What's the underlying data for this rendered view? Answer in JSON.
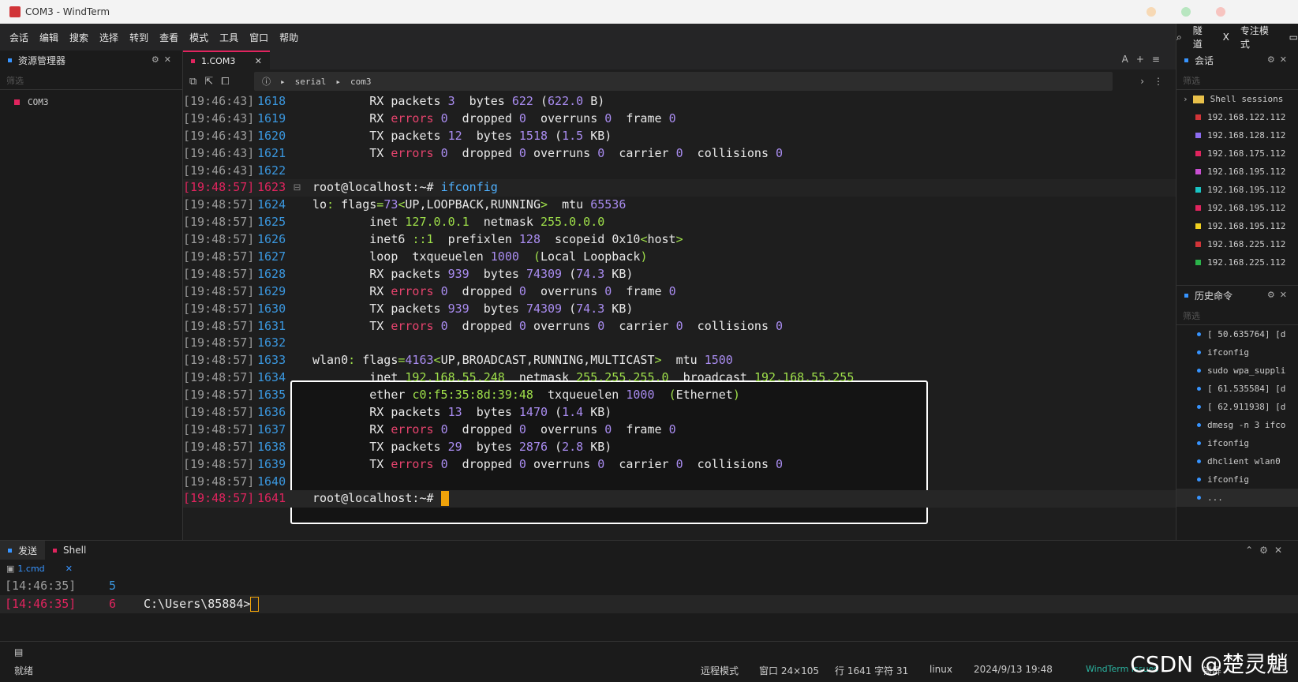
{
  "window": {
    "title": "COM3 - WindTerm"
  },
  "menu": [
    "会话",
    "编辑",
    "搜索",
    "选择",
    "转到",
    "查看",
    "模式",
    "工具",
    "窗口",
    "帮助"
  ],
  "menu_right": {
    "tunnel": "隧道",
    "x": "X",
    "focus": "专注模式"
  },
  "explorer": {
    "title": "资源管理器",
    "filter_placeholder": "筛选",
    "items": [
      {
        "label": "COM3",
        "color": "#e0245e"
      }
    ]
  },
  "tab": {
    "label": "1.COM3"
  },
  "address": {
    "p1": "serial",
    "p2": "com3"
  },
  "terminal": {
    "lines": [
      {
        "ts": "[19:46:43]",
        "ln": "1618",
        "parts": [
          [
            "",
            "        RX packets "
          ],
          [
            "num",
            "3"
          ],
          [
            "",
            "  bytes "
          ],
          [
            "num",
            "622"
          ],
          [
            "",
            " ("
          ],
          [
            "num",
            "622.0"
          ],
          [
            "",
            " B)"
          ]
        ]
      },
      {
        "ts": "[19:46:43]",
        "ln": "1619",
        "parts": [
          [
            "",
            "        RX "
          ],
          [
            "red",
            "errors"
          ],
          [
            "",
            " "
          ],
          [
            "num",
            "0"
          ],
          [
            "",
            "  dropped "
          ],
          [
            "num",
            "0"
          ],
          [
            "",
            "  overruns "
          ],
          [
            "num",
            "0"
          ],
          [
            "",
            "  frame "
          ],
          [
            "num",
            "0"
          ]
        ]
      },
      {
        "ts": "[19:46:43]",
        "ln": "1620",
        "parts": [
          [
            "",
            "        TX packets "
          ],
          [
            "num",
            "12"
          ],
          [
            "",
            "  bytes "
          ],
          [
            "num",
            "1518"
          ],
          [
            "",
            " ("
          ],
          [
            "num",
            "1.5"
          ],
          [
            "",
            " KB)"
          ]
        ]
      },
      {
        "ts": "[19:46:43]",
        "ln": "1621",
        "parts": [
          [
            "",
            "        TX "
          ],
          [
            "red",
            "errors"
          ],
          [
            "",
            " "
          ],
          [
            "num",
            "0"
          ],
          [
            "",
            "  dropped "
          ],
          [
            "num",
            "0"
          ],
          [
            "",
            " overruns "
          ],
          [
            "num",
            "0"
          ],
          [
            "",
            "  carrier "
          ],
          [
            "num",
            "0"
          ],
          [
            "",
            "  collisions "
          ],
          [
            "num",
            "0"
          ]
        ]
      },
      {
        "ts": "[19:46:43]",
        "ln": "1622",
        "parts": []
      },
      {
        "ts": "[19:48:57]",
        "ln": "1623",
        "parts": [
          [
            "",
            "root@localhost:~# "
          ],
          [
            "cmd",
            "ifconfig"
          ]
        ]
      },
      {
        "ts": "[19:48:57]",
        "ln": "1624",
        "parts": [
          [
            "",
            "lo"
          ],
          [
            "grn",
            ":"
          ],
          [
            "",
            " flags"
          ],
          [
            "grn",
            "="
          ],
          [
            "num",
            "73"
          ],
          [
            "grn",
            "<"
          ],
          [
            "",
            "UP,LOOPBACK,RUNNING"
          ],
          [
            "grn",
            ">"
          ],
          [
            "",
            "  mtu "
          ],
          [
            "num",
            "65536"
          ]
        ]
      },
      {
        "ts": "[19:48:57]",
        "ln": "1625",
        "parts": [
          [
            "",
            "        inet "
          ],
          [
            "grn",
            "127.0.0.1"
          ],
          [
            "",
            "  netmask "
          ],
          [
            "grn",
            "255.0.0.0"
          ]
        ]
      },
      {
        "ts": "[19:48:57]",
        "ln": "1626",
        "parts": [
          [
            "",
            "        inet6 "
          ],
          [
            "grn",
            "::1"
          ],
          [
            "",
            "  prefixlen "
          ],
          [
            "num",
            "128"
          ],
          [
            "",
            "  scopeid "
          ],
          [
            "",
            "0x10"
          ],
          [
            "grn",
            "<"
          ],
          [
            "",
            "host"
          ],
          [
            "grn",
            ">"
          ]
        ]
      },
      {
        "ts": "[19:48:57]",
        "ln": "1627",
        "parts": [
          [
            "",
            "        loop  txqueuelen "
          ],
          [
            "num",
            "1000"
          ],
          [
            "",
            "  "
          ],
          [
            "grn",
            "("
          ],
          [
            "",
            "Local Loopback"
          ],
          [
            "grn",
            ")"
          ]
        ]
      },
      {
        "ts": "[19:48:57]",
        "ln": "1628",
        "parts": [
          [
            "",
            "        RX packets "
          ],
          [
            "num",
            "939"
          ],
          [
            "",
            "  bytes "
          ],
          [
            "num",
            "74309"
          ],
          [
            "",
            " ("
          ],
          [
            "num",
            "74.3"
          ],
          [
            "",
            " KB)"
          ]
        ]
      },
      {
        "ts": "[19:48:57]",
        "ln": "1629",
        "parts": [
          [
            "",
            "        RX "
          ],
          [
            "red",
            "errors"
          ],
          [
            "",
            " "
          ],
          [
            "num",
            "0"
          ],
          [
            "",
            "  dropped "
          ],
          [
            "num",
            "0"
          ],
          [
            "",
            "  overruns "
          ],
          [
            "num",
            "0"
          ],
          [
            "",
            "  frame "
          ],
          [
            "num",
            "0"
          ]
        ]
      },
      {
        "ts": "[19:48:57]",
        "ln": "1630",
        "parts": [
          [
            "",
            "        TX packets "
          ],
          [
            "num",
            "939"
          ],
          [
            "",
            "  bytes "
          ],
          [
            "num",
            "74309"
          ],
          [
            "",
            " ("
          ],
          [
            "num",
            "74.3"
          ],
          [
            "",
            " KB)"
          ]
        ]
      },
      {
        "ts": "[19:48:57]",
        "ln": "1631",
        "parts": [
          [
            "",
            "        TX "
          ],
          [
            "red",
            "errors"
          ],
          [
            "",
            " "
          ],
          [
            "num",
            "0"
          ],
          [
            "",
            "  dropped "
          ],
          [
            "num",
            "0"
          ],
          [
            "",
            " overruns "
          ],
          [
            "num",
            "0"
          ],
          [
            "",
            "  carrier "
          ],
          [
            "num",
            "0"
          ],
          [
            "",
            "  collisions "
          ],
          [
            "num",
            "0"
          ]
        ]
      },
      {
        "ts": "[19:48:57]",
        "ln": "1632",
        "parts": []
      },
      {
        "ts": "[19:48:57]",
        "ln": "1633",
        "parts": [
          [
            "",
            "wlan0"
          ],
          [
            "grn",
            ":"
          ],
          [
            "",
            " flags"
          ],
          [
            "grn",
            "="
          ],
          [
            "num",
            "4163"
          ],
          [
            "grn",
            "<"
          ],
          [
            "",
            "UP,BROADCAST,RUNNING,MULTICAST"
          ],
          [
            "grn",
            ">"
          ],
          [
            "",
            "  mtu "
          ],
          [
            "num",
            "1500"
          ]
        ]
      },
      {
        "ts": "[19:48:57]",
        "ln": "1634",
        "parts": [
          [
            "",
            "        inet "
          ],
          [
            "grn",
            "192.168.55.248"
          ],
          [
            "",
            "  netmask "
          ],
          [
            "grn",
            "255.255.255.0"
          ],
          [
            "",
            "  broadcast "
          ],
          [
            "grn",
            "192.168.55.255"
          ]
        ]
      },
      {
        "ts": "[19:48:57]",
        "ln": "1635",
        "parts": [
          [
            "",
            "        ether "
          ],
          [
            "grn",
            "c0:f5:35:8d:39:48"
          ],
          [
            "",
            "  txqueuelen "
          ],
          [
            "num",
            "1000"
          ],
          [
            "",
            "  "
          ],
          [
            "grn",
            "("
          ],
          [
            "",
            "Ethernet"
          ],
          [
            "grn",
            ")"
          ]
        ]
      },
      {
        "ts": "[19:48:57]",
        "ln": "1636",
        "parts": [
          [
            "",
            "        RX packets "
          ],
          [
            "num",
            "13"
          ],
          [
            "",
            "  bytes "
          ],
          [
            "num",
            "1470"
          ],
          [
            "",
            " ("
          ],
          [
            "num",
            "1.4"
          ],
          [
            "",
            " KB)"
          ]
        ]
      },
      {
        "ts": "[19:48:57]",
        "ln": "1637",
        "parts": [
          [
            "",
            "        RX "
          ],
          [
            "red",
            "errors"
          ],
          [
            "",
            " "
          ],
          [
            "num",
            "0"
          ],
          [
            "",
            "  dropped "
          ],
          [
            "num",
            "0"
          ],
          [
            "",
            "  overruns "
          ],
          [
            "num",
            "0"
          ],
          [
            "",
            "  frame "
          ],
          [
            "num",
            "0"
          ]
        ]
      },
      {
        "ts": "[19:48:57]",
        "ln": "1638",
        "parts": [
          [
            "",
            "        TX packets "
          ],
          [
            "num",
            "29"
          ],
          [
            "",
            "  bytes "
          ],
          [
            "num",
            "2876"
          ],
          [
            "",
            " ("
          ],
          [
            "num",
            "2.8"
          ],
          [
            "",
            " KB)"
          ]
        ]
      },
      {
        "ts": "[19:48:57]",
        "ln": "1639",
        "parts": [
          [
            "",
            "        TX "
          ],
          [
            "red",
            "errors"
          ],
          [
            "",
            " "
          ],
          [
            "num",
            "0"
          ],
          [
            "",
            "  dropped "
          ],
          [
            "num",
            "0"
          ],
          [
            "",
            " overruns "
          ],
          [
            "num",
            "0"
          ],
          [
            "",
            "  carrier "
          ],
          [
            "num",
            "0"
          ],
          [
            "",
            "  collisions "
          ],
          [
            "num",
            "0"
          ]
        ]
      },
      {
        "ts": "[19:48:57]",
        "ln": "1640",
        "parts": []
      },
      {
        "ts": "[19:48:57]",
        "ln": "1641",
        "parts": [
          [
            "",
            "root@localhost:~# "
          ]
        ],
        "current": true
      }
    ]
  },
  "sessions": {
    "title": "会话",
    "filter_placeholder": "筛选",
    "folder": "Shell sessions",
    "items": [
      {
        "label": "192.168.122.112",
        "color": "#d13438"
      },
      {
        "label": "192.168.128.112",
        "color": "#8c6cf0"
      },
      {
        "label": "192.168.175.112",
        "color": "#e0245e"
      },
      {
        "label": "192.168.195.112",
        "color": "#c94fd1"
      },
      {
        "label": "192.168.195.112",
        "color": "#19c3c3"
      },
      {
        "label": "192.168.195.112",
        "color": "#e0245e"
      },
      {
        "label": "192.168.195.112",
        "color": "#f0d020"
      },
      {
        "label": "192.168.225.112",
        "color": "#d13438"
      },
      {
        "label": "192.168.225.112",
        "color": "#2bb34a"
      }
    ]
  },
  "history": {
    "title": "历史命令",
    "filter_placeholder": "筛选",
    "items": [
      "[ 50.635764] [d",
      "ifconfig",
      "sudo wpa_suppli",
      "[ 61.535584] [d",
      "[ 62.911938] [d",
      "dmesg -n 3 ifco",
      "ifconfig",
      "dhclient wlan0",
      "ifconfig",
      "..."
    ]
  },
  "bottom": {
    "tabs": [
      {
        "label": "发送",
        "color": "#3794ff"
      },
      {
        "label": "Shell",
        "color": "#e0245e"
      }
    ],
    "subtab": "1.cmd",
    "lines": [
      {
        "ts": "[14:46:35]",
        "ln": "5",
        "txt": ""
      },
      {
        "ts": "[14:46:35]",
        "ln": "6",
        "txt": "C:\\Users\\85884>",
        "current": true
      }
    ]
  },
  "status": {
    "ready": "就绪",
    "remote_mode": "远程模式",
    "window_size": "窗口 24×105",
    "position": "行 1641 字符 31",
    "os": "linux",
    "datetime": "2024/9/13 19:48",
    "issues": "WindTerm Issues",
    "lock": "锁屏"
  },
  "watermark": "CSDN @楚灵魈"
}
